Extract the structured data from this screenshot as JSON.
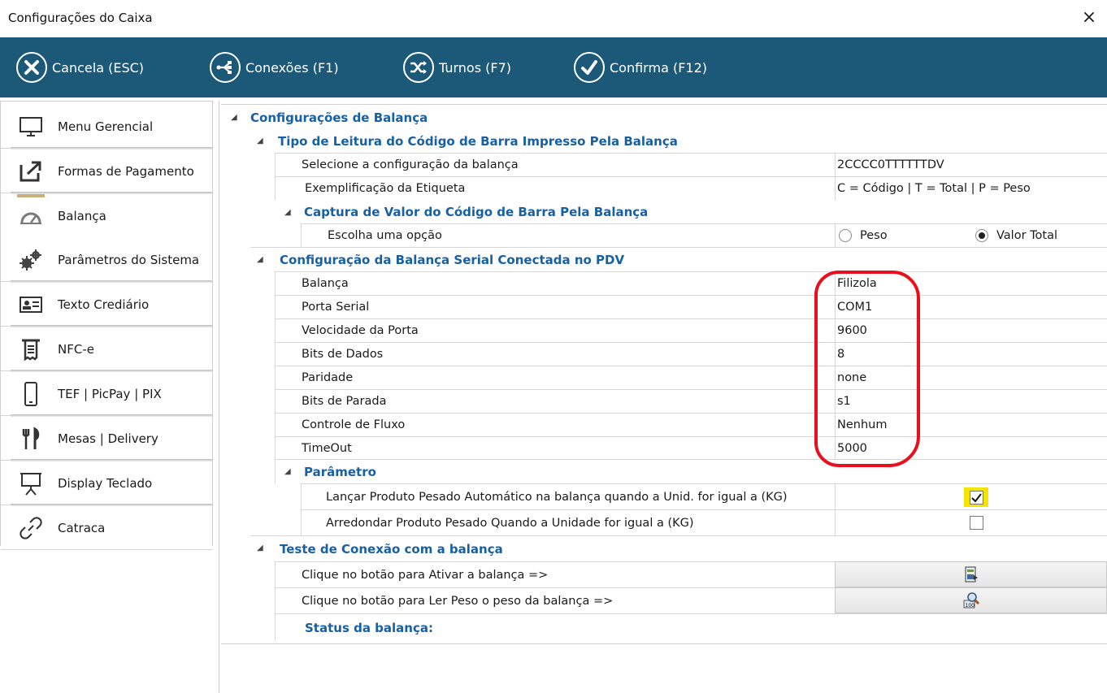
{
  "window": {
    "title": "Configurações do Caixa",
    "close_glyph": "×"
  },
  "toolbar": {
    "cancel_label": "Cancela (ESC)",
    "connections_label": "Conexões (F1)",
    "shifts_label": "Turnos (F7)",
    "confirm_label": "Confirma (F12)"
  },
  "sidebar": {
    "items": [
      {
        "label": "Menu Gerencial",
        "icon": "monitor-icon"
      },
      {
        "label": "Formas de Pagamento",
        "icon": "export-icon"
      },
      {
        "label": "Balança",
        "icon": "gauge-icon",
        "active": true
      },
      {
        "label": "Parâmetros do Sistema",
        "icon": "gears-icon"
      },
      {
        "label": "Texto Crediário",
        "icon": "id-card-icon"
      },
      {
        "label": "NFC-e",
        "icon": "receipt-icon"
      },
      {
        "label": "TEF | PicPay | PIX",
        "icon": "smartphone-icon"
      },
      {
        "label": "Mesas | Delivery",
        "icon": "cutlery-icon"
      },
      {
        "label": "Display Teclado",
        "icon": "presentation-icon"
      },
      {
        "label": "Catraca",
        "icon": "link-icon"
      }
    ]
  },
  "grid": {
    "root_category": "Configurações de Balança",
    "barcode_type": {
      "title": "Tipo de Leitura do Código de Barra Impresso Pela Balança",
      "select_label": "Selecione a configuração da balança",
      "select_value": "2CCCC0TTTTTTDV",
      "example_label": "Exemplificação da Etiqueta",
      "example_value": "C = Código | T = Total | P = Peso",
      "capture": {
        "title": "Captura de Valor do Código de Barra Pela Balança",
        "option_label": "Escolha uma opção",
        "option_weight": "Peso",
        "option_total": "Valor Total",
        "selected": "Valor Total"
      }
    },
    "serial": {
      "title": "Configuração da Balança Serial Conectada no PDV",
      "rows": [
        {
          "label": "Balança",
          "value": "Filizola"
        },
        {
          "label": "Porta Serial",
          "value": "COM1"
        },
        {
          "label": "Velocidade da Porta",
          "value": "9600"
        },
        {
          "label": "Bits de Dados",
          "value": "8"
        },
        {
          "label": "Paridade",
          "value": "none"
        },
        {
          "label": "Bits de Parada",
          "value": "s1"
        },
        {
          "label": "Controle de Fluxo",
          "value": "Nenhum"
        },
        {
          "label": "TimeOut",
          "value": "5000"
        }
      ],
      "parameter": {
        "title": "Parâmetro",
        "auto_launch_label": "Lançar Produto Pesado Automático na balança quando a Unid. for igual a (KG)",
        "auto_launch_checked": true,
        "round_label": "Arredondar Produto Pesado Quando a Unidade for igual a (KG)",
        "round_checked": false
      }
    },
    "connection_test": {
      "title": "Teste de Conexão com a balança",
      "activate_label": "Clique no botão para Ativar a balança =>",
      "read_label": "Clique no botão para Ler Peso o peso da balança =>",
      "status_label": "Status da balança:"
    }
  },
  "colors": {
    "toolbar": "#1c5979",
    "category": "#1760a3",
    "highlight_circle": "#e8101d",
    "checkbox_highlight": "#f5e400"
  }
}
